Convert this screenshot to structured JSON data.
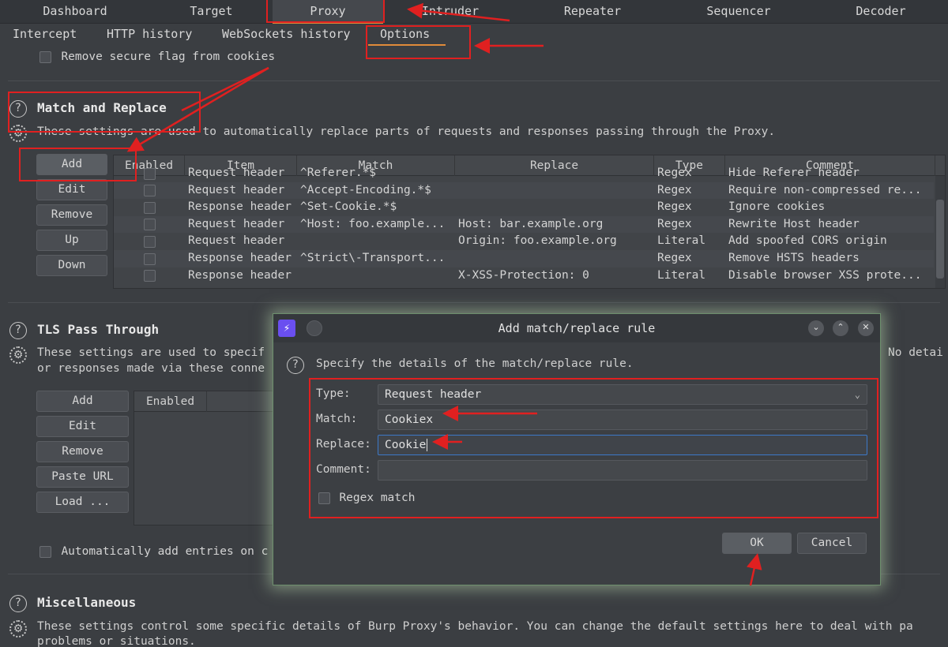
{
  "top_tabs": [
    "Dashboard",
    "Target",
    "Proxy",
    "Intruder",
    "Repeater",
    "Sequencer",
    "Decoder"
  ],
  "sub_tabs": [
    "Intercept",
    "HTTP history",
    "WebSockets history",
    "Options"
  ],
  "cookies_option": "Remove secure flag from cookies",
  "match_replace": {
    "title": "Match and Replace",
    "description": "These settings are used to automatically replace parts of requests and responses passing through the Proxy.",
    "buttons": [
      "Add",
      "Edit",
      "Remove",
      "Up",
      "Down"
    ],
    "columns": [
      "Enabled",
      "Item",
      "Match",
      "Replace",
      "Type",
      "Comment"
    ],
    "rows": [
      {
        "item": "Request header",
        "match": "^Referer.*$",
        "replace": "",
        "type": "Regex",
        "comment": "Hide Referer header"
      },
      {
        "item": "Request header",
        "match": "^Accept-Encoding.*$",
        "replace": "",
        "type": "Regex",
        "comment": "Require non-compressed re..."
      },
      {
        "item": "Response header",
        "match": "^Set-Cookie.*$",
        "replace": "",
        "type": "Regex",
        "comment": "Ignore cookies"
      },
      {
        "item": "Request header",
        "match": "^Host: foo.example...",
        "replace": "Host: bar.example.org",
        "type": "Regex",
        "comment": "Rewrite Host header"
      },
      {
        "item": "Request header",
        "match": "",
        "replace": "Origin: foo.example.org",
        "type": "Literal",
        "comment": "Add spoofed CORS origin"
      },
      {
        "item": "Response header",
        "match": "^Strict\\-Transport...",
        "replace": "",
        "type": "Regex",
        "comment": "Remove HSTS headers"
      },
      {
        "item": "Response header",
        "match": "",
        "replace": "X-XSS-Protection: 0",
        "type": "Literal",
        "comment": "Disable browser XSS prote..."
      }
    ]
  },
  "tls": {
    "title": "TLS Pass Through",
    "description_1": "These settings are used to specif",
    "description_2": "or responses made via these conne",
    "description_right": "No detai",
    "buttons": [
      "Add",
      "Edit",
      "Remove",
      "Paste URL",
      "Load ..."
    ],
    "column": "Enabled",
    "auto_add": "Automatically add entries on c"
  },
  "misc": {
    "title": "Miscellaneous",
    "description_1": "These settings control some specific details of Burp Proxy's behavior. You can change the default settings here to deal with pa",
    "description_2": "problems or situations."
  },
  "dialog": {
    "title": "Add match/replace rule",
    "instructions": "Specify the details of the match/replace rule.",
    "type_label": "Type:",
    "type_value": "Request header",
    "match_label": "Match:",
    "match_value": "Cookiex",
    "replace_label": "Replace:",
    "replace_value": "Cookie",
    "comment_label": "Comment:",
    "comment_value": "",
    "regex_label": "Regex match",
    "ok": "OK",
    "cancel": "Cancel"
  },
  "colors": {
    "accent": "#e08b3a",
    "annotation": "#e02020",
    "dialog_glow": "#b4d2aa"
  }
}
